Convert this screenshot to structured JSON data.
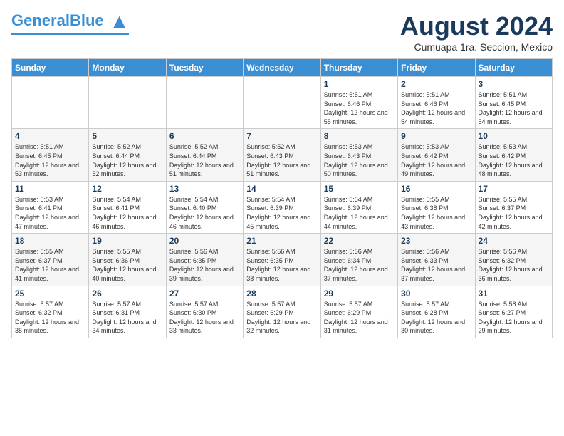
{
  "header": {
    "logo_general": "General",
    "logo_blue": "Blue",
    "month_title": "August 2024",
    "subtitle": "Cumuapa 1ra. Seccion, Mexico"
  },
  "days_of_week": [
    "Sunday",
    "Monday",
    "Tuesday",
    "Wednesday",
    "Thursday",
    "Friday",
    "Saturday"
  ],
  "weeks": [
    [
      {
        "day": "",
        "sunrise": "",
        "sunset": "",
        "daylight": ""
      },
      {
        "day": "",
        "sunrise": "",
        "sunset": "",
        "daylight": ""
      },
      {
        "day": "",
        "sunrise": "",
        "sunset": "",
        "daylight": ""
      },
      {
        "day": "",
        "sunrise": "",
        "sunset": "",
        "daylight": ""
      },
      {
        "day": "1",
        "sunrise": "5:51 AM",
        "sunset": "6:46 PM",
        "daylight": "12 hours and 55 minutes."
      },
      {
        "day": "2",
        "sunrise": "5:51 AM",
        "sunset": "6:46 PM",
        "daylight": "12 hours and 54 minutes."
      },
      {
        "day": "3",
        "sunrise": "5:51 AM",
        "sunset": "6:45 PM",
        "daylight": "12 hours and 54 minutes."
      }
    ],
    [
      {
        "day": "4",
        "sunrise": "5:51 AM",
        "sunset": "6:45 PM",
        "daylight": "12 hours and 53 minutes."
      },
      {
        "day": "5",
        "sunrise": "5:52 AM",
        "sunset": "6:44 PM",
        "daylight": "12 hours and 52 minutes."
      },
      {
        "day": "6",
        "sunrise": "5:52 AM",
        "sunset": "6:44 PM",
        "daylight": "12 hours and 51 minutes."
      },
      {
        "day": "7",
        "sunrise": "5:52 AM",
        "sunset": "6:43 PM",
        "daylight": "12 hours and 51 minutes."
      },
      {
        "day": "8",
        "sunrise": "5:53 AM",
        "sunset": "6:43 PM",
        "daylight": "12 hours and 50 minutes."
      },
      {
        "day": "9",
        "sunrise": "5:53 AM",
        "sunset": "6:42 PM",
        "daylight": "12 hours and 49 minutes."
      },
      {
        "day": "10",
        "sunrise": "5:53 AM",
        "sunset": "6:42 PM",
        "daylight": "12 hours and 48 minutes."
      }
    ],
    [
      {
        "day": "11",
        "sunrise": "5:53 AM",
        "sunset": "6:41 PM",
        "daylight": "12 hours and 47 minutes."
      },
      {
        "day": "12",
        "sunrise": "5:54 AM",
        "sunset": "6:41 PM",
        "daylight": "12 hours and 46 minutes."
      },
      {
        "day": "13",
        "sunrise": "5:54 AM",
        "sunset": "6:40 PM",
        "daylight": "12 hours and 46 minutes."
      },
      {
        "day": "14",
        "sunrise": "5:54 AM",
        "sunset": "6:39 PM",
        "daylight": "12 hours and 45 minutes."
      },
      {
        "day": "15",
        "sunrise": "5:54 AM",
        "sunset": "6:39 PM",
        "daylight": "12 hours and 44 minutes."
      },
      {
        "day": "16",
        "sunrise": "5:55 AM",
        "sunset": "6:38 PM",
        "daylight": "12 hours and 43 minutes."
      },
      {
        "day": "17",
        "sunrise": "5:55 AM",
        "sunset": "6:37 PM",
        "daylight": "12 hours and 42 minutes."
      }
    ],
    [
      {
        "day": "18",
        "sunrise": "5:55 AM",
        "sunset": "6:37 PM",
        "daylight": "12 hours and 41 minutes."
      },
      {
        "day": "19",
        "sunrise": "5:55 AM",
        "sunset": "6:36 PM",
        "daylight": "12 hours and 40 minutes."
      },
      {
        "day": "20",
        "sunrise": "5:56 AM",
        "sunset": "6:35 PM",
        "daylight": "12 hours and 39 minutes."
      },
      {
        "day": "21",
        "sunrise": "5:56 AM",
        "sunset": "6:35 PM",
        "daylight": "12 hours and 38 minutes."
      },
      {
        "day": "22",
        "sunrise": "5:56 AM",
        "sunset": "6:34 PM",
        "daylight": "12 hours and 37 minutes."
      },
      {
        "day": "23",
        "sunrise": "5:56 AM",
        "sunset": "6:33 PM",
        "daylight": "12 hours and 37 minutes."
      },
      {
        "day": "24",
        "sunrise": "5:56 AM",
        "sunset": "6:32 PM",
        "daylight": "12 hours and 36 minutes."
      }
    ],
    [
      {
        "day": "25",
        "sunrise": "5:57 AM",
        "sunset": "6:32 PM",
        "daylight": "12 hours and 35 minutes."
      },
      {
        "day": "26",
        "sunrise": "5:57 AM",
        "sunset": "6:31 PM",
        "daylight": "12 hours and 34 minutes."
      },
      {
        "day": "27",
        "sunrise": "5:57 AM",
        "sunset": "6:30 PM",
        "daylight": "12 hours and 33 minutes."
      },
      {
        "day": "28",
        "sunrise": "5:57 AM",
        "sunset": "6:29 PM",
        "daylight": "12 hours and 32 minutes."
      },
      {
        "day": "29",
        "sunrise": "5:57 AM",
        "sunset": "6:29 PM",
        "daylight": "12 hours and 31 minutes."
      },
      {
        "day": "30",
        "sunrise": "5:57 AM",
        "sunset": "6:28 PM",
        "daylight": "12 hours and 30 minutes."
      },
      {
        "day": "31",
        "sunrise": "5:58 AM",
        "sunset": "6:27 PM",
        "daylight": "12 hours and 29 minutes."
      }
    ]
  ],
  "labels": {
    "sunrise_label": "Sunrise:",
    "sunset_label": "Sunset:",
    "daylight_label": "Daylight:"
  }
}
